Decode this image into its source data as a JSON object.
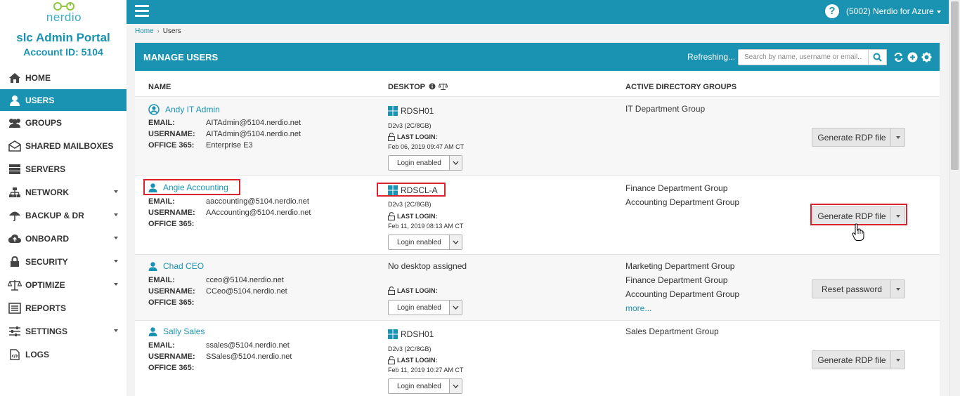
{
  "brand": {
    "logo_text": "nerdio",
    "portal_title": "slc Admin Portal",
    "account_id": "Account ID: 5104"
  },
  "topbar": {
    "account_label": "(5002) Nerdio for Azure",
    "help_icon": "help-circle-icon"
  },
  "nav": [
    {
      "label": "HOME",
      "icon": "home-icon",
      "active": false,
      "dropdown": false
    },
    {
      "label": "USERS",
      "icon": "user-icon",
      "active": true,
      "dropdown": false
    },
    {
      "label": "GROUPS",
      "icon": "users-icon",
      "active": false,
      "dropdown": false
    },
    {
      "label": "SHARED MAILBOXES",
      "icon": "envelope-icon",
      "active": false,
      "dropdown": false
    },
    {
      "label": "SERVERS",
      "icon": "server-icon",
      "active": false,
      "dropdown": false
    },
    {
      "label": "NETWORK",
      "icon": "network-icon",
      "active": false,
      "dropdown": true
    },
    {
      "label": "BACKUP & DR",
      "icon": "umbrella-icon",
      "active": false,
      "dropdown": true
    },
    {
      "label": "ONBOARD",
      "icon": "cloud-upload-icon",
      "active": false,
      "dropdown": true
    },
    {
      "label": "SECURITY",
      "icon": "lock-icon",
      "active": false,
      "dropdown": true
    },
    {
      "label": "OPTIMIZE",
      "icon": "balance-scale-icon",
      "active": false,
      "dropdown": true
    },
    {
      "label": "REPORTS",
      "icon": "list-icon",
      "active": false,
      "dropdown": false
    },
    {
      "label": "SETTINGS",
      "icon": "sliders-icon",
      "active": false,
      "dropdown": true
    },
    {
      "label": "LOGS",
      "icon": "code-file-icon",
      "active": false,
      "dropdown": false
    }
  ],
  "breadcrumb": {
    "home": "Home",
    "current": "Users"
  },
  "panel": {
    "title": "MANAGE USERS",
    "refreshing": "Refreshing...",
    "search_placeholder": "Search by name, username or email..."
  },
  "columns": {
    "name": "NAME",
    "desktop": "DESKTOP",
    "groups": "ACTIVE DIRECTORY GROUPS"
  },
  "field_labels": {
    "email": "EMAIL:",
    "username": "USERNAME:",
    "office": "OFFICE 365:",
    "last_login": "LAST LOGIN:"
  },
  "users": [
    {
      "name": "Andy IT Admin",
      "icon": "user-circle-icon",
      "email": "AITAdmin@5104.nerdio.net",
      "username": "AITAdmin@5104.nerdio.net",
      "office365": "Enterprise E3",
      "desktop": "RDSH01",
      "desktop_spec": "D2v3 (2C/8GB)",
      "last_login": "Feb 06, 2019 09:47 AM CT",
      "login_status": "Login enabled",
      "groups": [
        "IT Department Group"
      ],
      "more": "",
      "action": "Generate RDP file"
    },
    {
      "name": "Angie Accounting",
      "icon": "user-icon",
      "email": "aaccounting@5104.nerdio.net",
      "username": "AAccounting@5104.nerdio.net",
      "office365": "",
      "desktop": "RDSCL-A",
      "desktop_spec": "D2v3 (2C/8GB)",
      "last_login": "Feb 11, 2019 08:13 AM CT",
      "login_status": "Login enabled",
      "groups": [
        "Finance Department Group",
        "Accounting Department Group"
      ],
      "more": "",
      "action": "Generate RDP file"
    },
    {
      "name": "Chad CEO",
      "icon": "user-icon",
      "email": "cceo@5104.nerdio.net",
      "username": "CCeo@5104.nerdio.net",
      "office365": "",
      "desktop": "",
      "no_desktop": "No desktop assigned",
      "desktop_spec": "",
      "last_login": "",
      "login_status": "Login enabled",
      "groups": [
        "Marketing Department Group",
        "Finance Department Group",
        "Accounting Department Group"
      ],
      "more": "more...",
      "action": "Reset password"
    },
    {
      "name": "Sally Sales",
      "icon": "user-icon",
      "email": "ssales@5104.nerdio.net",
      "username": "SSales@5104.nerdio.net",
      "office365": "",
      "desktop": "RDSH01",
      "desktop_spec": "D2v3 (2C/8GB)",
      "last_login": "Feb 11, 2019 10:27 AM CT",
      "login_status": "Login enabled",
      "groups": [
        "Sales Department Group"
      ],
      "more": "",
      "action": "Generate RDP file"
    }
  ],
  "colors": {
    "accent": "#1a93b3",
    "highlight": "#d9232e"
  }
}
